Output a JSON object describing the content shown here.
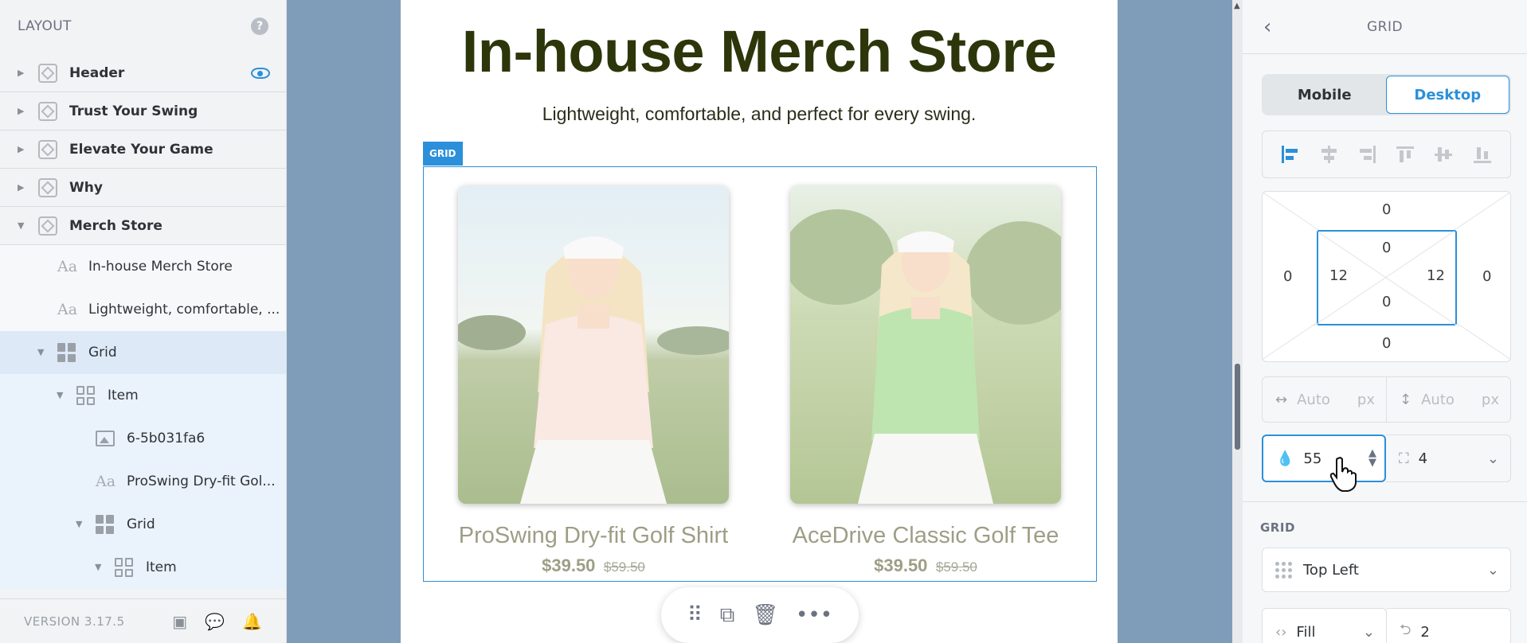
{
  "sidebar": {
    "title": "LAYOUT",
    "help": "?",
    "items": [
      {
        "label": "Header"
      },
      {
        "label": "Trust Your Swing"
      },
      {
        "label": "Elevate Your Game"
      },
      {
        "label": "Why"
      },
      {
        "label": "Merch Store"
      }
    ],
    "children": [
      {
        "label": "In-house Merch Store"
      },
      {
        "label": "Lightweight, comfortable, ..."
      },
      {
        "label": "Grid"
      },
      {
        "label": "Item"
      },
      {
        "label": "6-5b031fa6"
      },
      {
        "label": "ProSwing Dry-fit Gol..."
      },
      {
        "label": "Grid"
      },
      {
        "label": "Item"
      }
    ],
    "version": "VERSION 3.17.5"
  },
  "canvas": {
    "title": "In-house Merch Store",
    "subtitle": "Lightweight, comfortable, and perfect for every swing.",
    "grid_tag": "GRID",
    "products": [
      {
        "name": "ProSwing Dry-fit Golf Shirt",
        "price": "$39.50",
        "old_price": "$59.50",
        "shirt_color": "#f6d7cf"
      },
      {
        "name": "AceDrive Classic Golf Tee",
        "price": "$39.50",
        "old_price": "$59.50",
        "shirt_color": "#8fd276"
      }
    ]
  },
  "panel": {
    "title": "GRID",
    "tabs": {
      "mobile": "Mobile",
      "desktop": "Desktop"
    },
    "margin": {
      "top": "0",
      "right": "0",
      "bottom": "0",
      "left": "0"
    },
    "padding": {
      "top": "0",
      "right": "12",
      "bottom": "0",
      "left": "12"
    },
    "width": {
      "value": "Auto",
      "unit": "px"
    },
    "height": {
      "value": "Auto",
      "unit": "px"
    },
    "opacity": "55",
    "radius": "4",
    "grid_section": "GRID",
    "alignment": "Top Left",
    "sizing": "Fill",
    "columns": "2"
  },
  "colors": {
    "accent": "#2b90d9",
    "heading": "#2c360a"
  }
}
